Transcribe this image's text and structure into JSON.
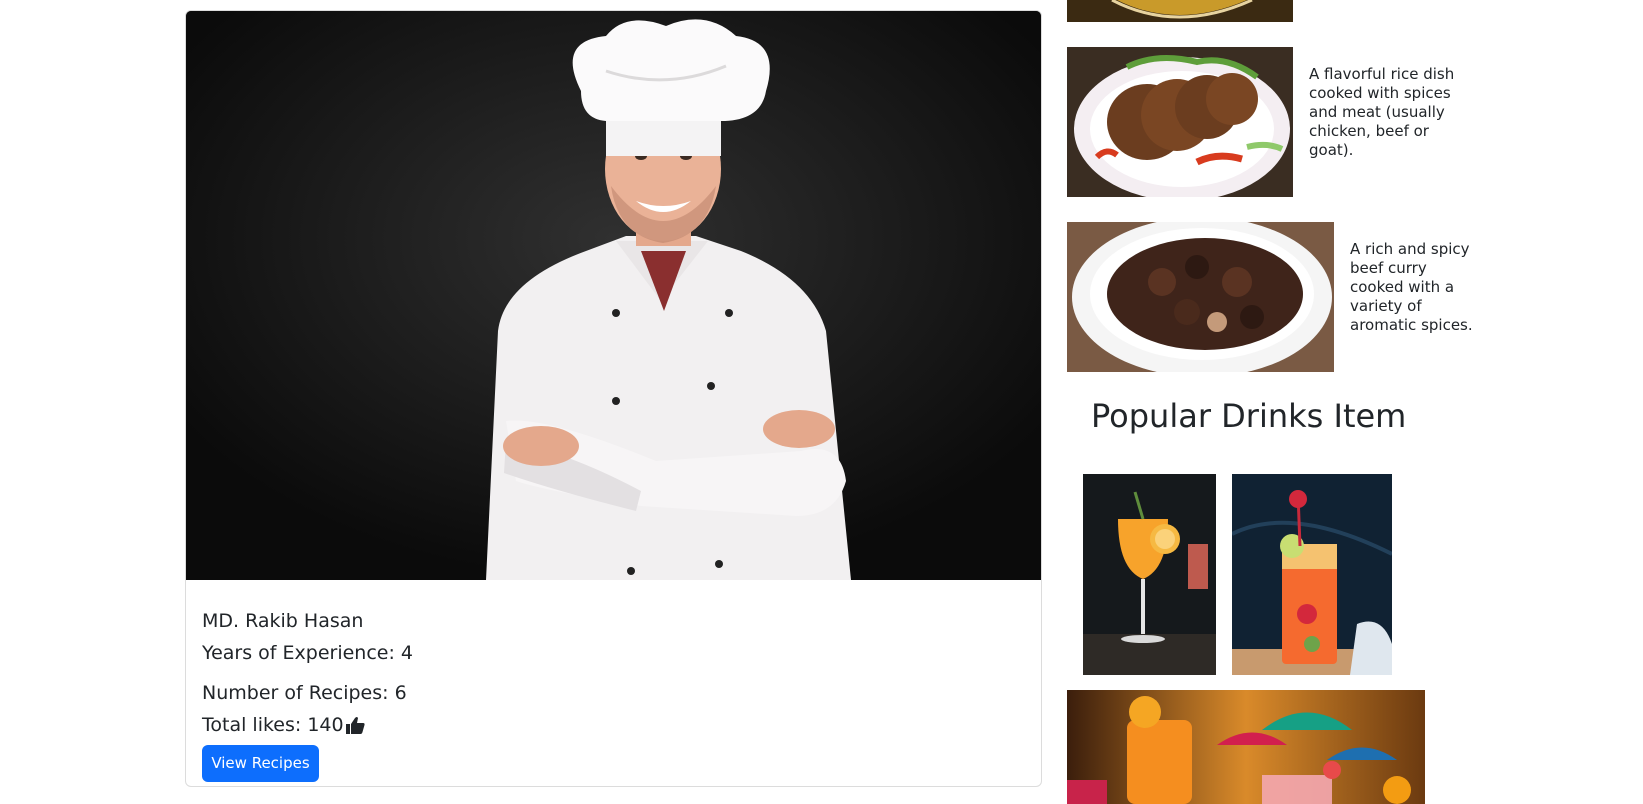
{
  "chef": {
    "name": "MD. Rakib Hasan",
    "experience": "Years of Experience: 4",
    "recipes": "Number of Recipes: 6",
    "likes": "Total likes: 140",
    "view_button": "View Recipes",
    "photo_icon": "chef-portrait"
  },
  "popular_food": {
    "items": [
      {
        "image": "curry-dish-photo"
      },
      {
        "image": "kebab-plate-photo",
        "description": "A flavorful rice dish cooked with spices and meat (usually chicken, beef or goat)."
      },
      {
        "image": "beef-curry-photo",
        "description": "A rich and spicy beef curry cooked with a variety of aromatic spices."
      }
    ]
  },
  "popular_drinks": {
    "title": "Popular Drinks Item",
    "items": [
      {
        "image": "orange-cocktail-photo"
      },
      {
        "image": "strawberry-drink-photo"
      },
      {
        "image": "umbrella-cocktails-photo"
      }
    ]
  },
  "colors": {
    "primary": "#0d6efd",
    "text": "#212529",
    "border": "#dcdcdc"
  }
}
